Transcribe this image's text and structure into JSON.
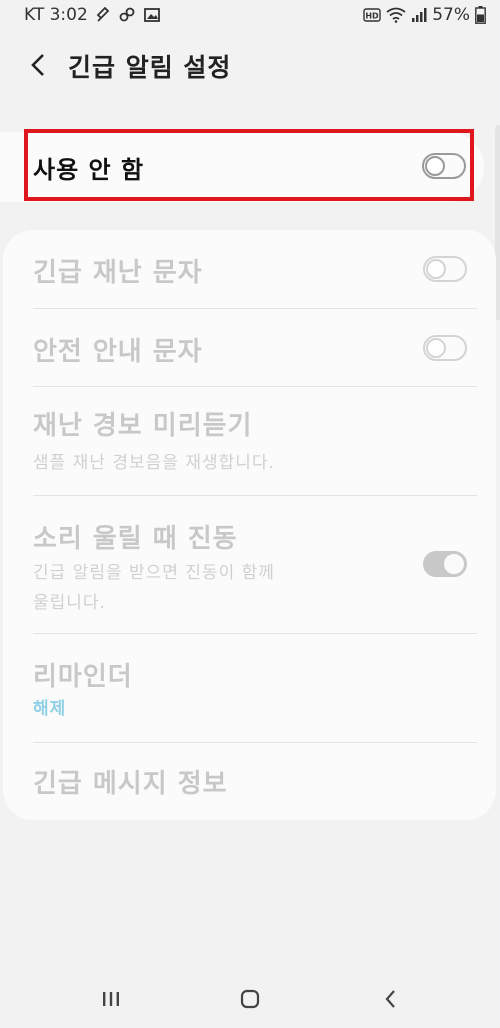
{
  "status_bar": {
    "carrier_time": "KT 3:02",
    "battery_percent": "57%",
    "icons": [
      "link-icon",
      "image-icon",
      "hd-icon",
      "wifi-icon",
      "signal-icon",
      "battery-icon"
    ]
  },
  "header": {
    "back_icon": "chevron-left-icon",
    "title": "긴급 알림 설정"
  },
  "master_toggle": {
    "label": "사용 안 함",
    "state": "off"
  },
  "settings": {
    "items": [
      {
        "title": "긴급 재난 문자",
        "toggle": "off"
      },
      {
        "title": "안전 안내 문자",
        "toggle": "off"
      },
      {
        "title": "재난 경보 미리듣기",
        "subtitle": "샘플 재난 경보음을 재생합니다."
      },
      {
        "title": "소리 울릴 때 진동",
        "subtitle_line1": "긴급 알림을 받으면 진동이 함께",
        "subtitle_line2": "울립니다.",
        "toggle": "on"
      },
      {
        "title": "리마인더",
        "subtitle": "해제"
      },
      {
        "title": "긴급 메시지 정보"
      }
    ]
  },
  "colors": {
    "background": "#f2f2f2",
    "card": "#fbfbfb",
    "highlight": "#e0161f",
    "accent_subtitle": "#8fd0e6",
    "disabled_text": "#c8c8c8"
  },
  "nav_bar": {
    "icons": [
      "recent-apps-icon",
      "home-icon",
      "back-icon"
    ]
  }
}
